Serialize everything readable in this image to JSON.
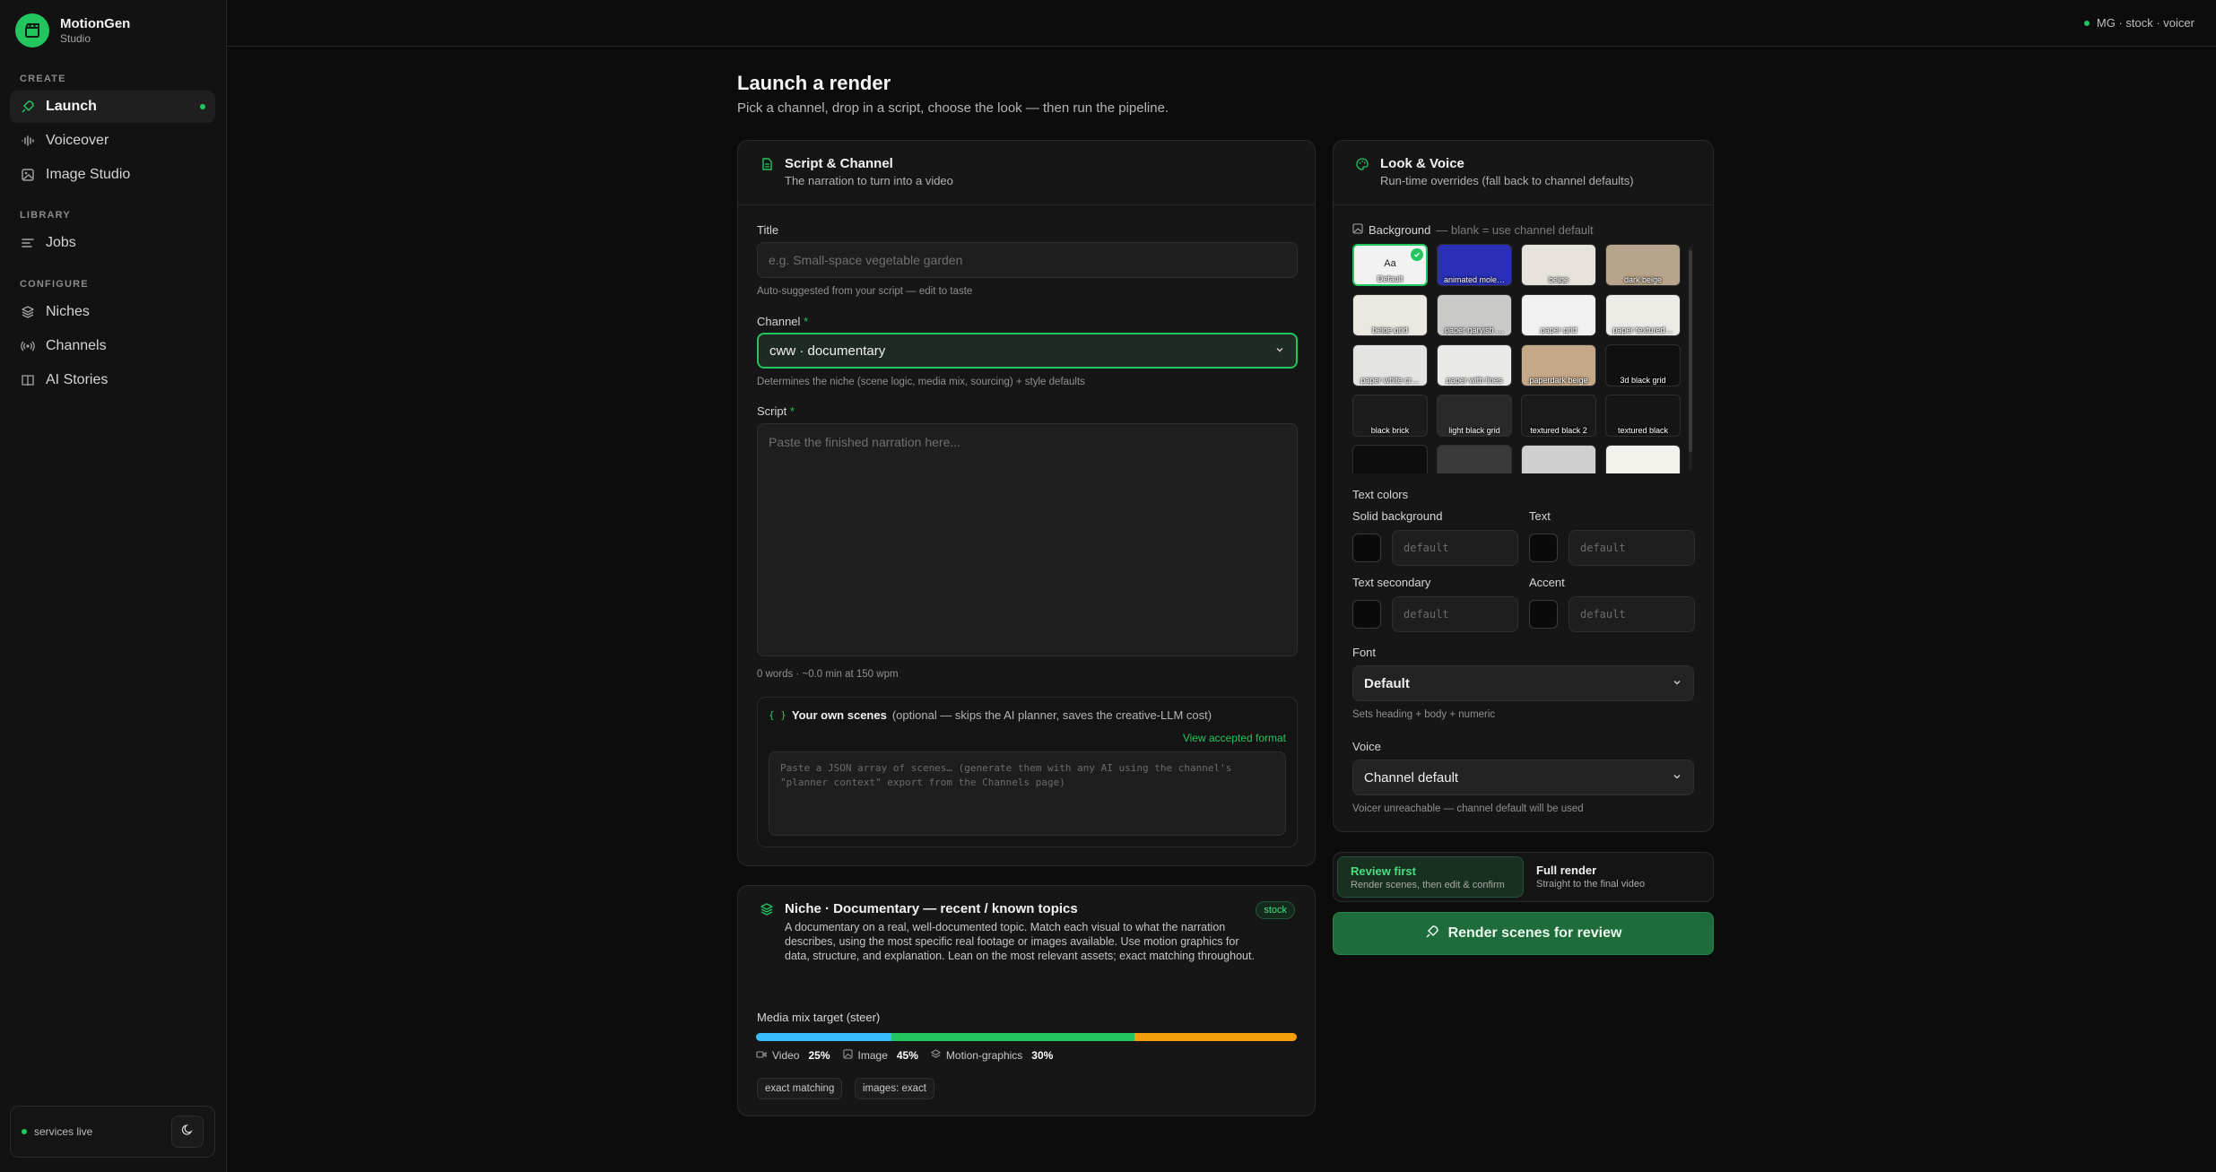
{
  "brand": {
    "name": "MotionGen",
    "sub": "Studio"
  },
  "sidebar": {
    "sections": [
      {
        "label": "CREATE"
      },
      {
        "label": "LIBRARY"
      },
      {
        "label": "CONFIGURE"
      }
    ],
    "items": [
      {
        "label": "Launch",
        "icon": "rocket-icon",
        "active": true
      },
      {
        "label": "Voiceover",
        "icon": "audio-wave-icon"
      },
      {
        "label": "Image Studio",
        "icon": "image-icon"
      },
      {
        "label": "Jobs",
        "icon": "list-icon"
      },
      {
        "label": "Niches",
        "icon": "layers-icon"
      },
      {
        "label": "Channels",
        "icon": "broadcast-icon"
      },
      {
        "label": "AI Stories",
        "icon": "book-icon"
      }
    ],
    "status": "services live"
  },
  "topbar": {
    "status": "MG · stock · voicer"
  },
  "page": {
    "title": "Launch a render",
    "subtitle": "Pick a channel, drop in a script, choose the look — then run the pipeline."
  },
  "script_card": {
    "title": "Script & Channel",
    "subtitle": "The narration to turn into a video",
    "title_label": "Title",
    "title_placeholder": "e.g. Small-space vegetable garden",
    "title_hint": "Auto-suggested from your script — edit to taste",
    "channel_label": "Channel",
    "channel_value": "cww · documentary",
    "channel_hint": "Determines the niche (scene logic, media mix, sourcing) + style defaults",
    "script_label": "Script",
    "script_placeholder": "Paste the finished narration here...",
    "script_stats": "0 words · ~0.0 min at 150 wpm",
    "req_mark": "*",
    "scenes": {
      "icon_text": "{ }",
      "title": "Your own scenes",
      "note": "(optional — skips the AI planner, saves the creative-LLM cost)",
      "link": "View accepted format",
      "placeholder": "Paste a JSON array of scenes… (generate them with any AI using the channel's \"planner context\" export from the Channels page)"
    }
  },
  "niche_card": {
    "title": "Niche · Documentary — recent / known topics",
    "badge": "stock",
    "description": "A documentary on a real, well-documented topic. Match each visual to what the narration describes, using the most specific real footage or images available. Use motion graphics for data, structure, and explanation. Lean on the most relevant assets; exact matching throughout.",
    "mix_label": "Media mix target (steer)",
    "mix": [
      {
        "name": "Video",
        "value": "25%",
        "fraction": 0.25,
        "color": "#38bdf8",
        "icon": "video-icon"
      },
      {
        "name": "Image",
        "value": "45%",
        "fraction": 0.45,
        "color": "#22c55e",
        "icon": "image-icon"
      },
      {
        "name": "Motion-graphics",
        "value": "30%",
        "fraction": 0.3,
        "color": "#f59e0b",
        "icon": "layers-icon"
      }
    ],
    "chips": [
      "exact matching",
      "images: exact"
    ]
  },
  "look_card": {
    "title": "Look & Voice",
    "subtitle": "Run-time overrides (fall back to channel defaults)",
    "background_label": "Background",
    "background_hint": "— blank = use channel default",
    "tiles": [
      {
        "name": "Default",
        "glyph": "Aa",
        "selected": true,
        "color": "#f2f2f2"
      },
      {
        "name": "animated mole…",
        "color": "#2a2fb8"
      },
      {
        "name": "beige",
        "color": "#e7e3dc"
      },
      {
        "name": "dark beige",
        "color": "#b8a48a"
      },
      {
        "name": "beige grid",
        "color": "#ebe8e2"
      },
      {
        "name": "paper garyish …",
        "color": "#c9c9c7"
      },
      {
        "name": "paper grid",
        "color": "#f1f1f1"
      },
      {
        "name": "paper textured…",
        "color": "#ecebe6"
      },
      {
        "name": "paper white cr…",
        "color": "#e4e4e2"
      },
      {
        "name": "paper with lines",
        "color": "#e9e9e7"
      },
      {
        "name": "paperdark beige",
        "color": "#c4a887"
      },
      {
        "name": "3d black grid",
        "color": "#101010"
      },
      {
        "name": "black brick",
        "color": "#1c1c1c"
      },
      {
        "name": "light black grid",
        "color": "#2a2a2a"
      },
      {
        "name": "textured black 2",
        "color": "#1a1a1a"
      },
      {
        "name": "textured black",
        "color": "#161616"
      },
      {
        "name": "",
        "color": "#0d0d0d"
      },
      {
        "name": "",
        "color": "#3a3a3a"
      },
      {
        "name": "",
        "color": "#cfcfcf"
      },
      {
        "name": "",
        "color": "#f4f2ec"
      }
    ],
    "text_colors_label": "Text colors",
    "colors": [
      {
        "label": "Solid background",
        "placeholder": "default"
      },
      {
        "label": "Text",
        "placeholder": "default"
      },
      {
        "label": "Text secondary",
        "placeholder": "default"
      },
      {
        "label": "Accent",
        "placeholder": "default"
      }
    ],
    "font_label": "Font",
    "font_value": "Default",
    "font_hint": "Sets heading + body + numeric",
    "voice_label": "Voice",
    "voice_value": "Channel default",
    "voice_hint": "Voicer unreachable — channel default will be used"
  },
  "modes": [
    {
      "title": "Review first",
      "sub": "Render scenes, then edit & confirm",
      "active": true
    },
    {
      "title": "Full render",
      "sub": "Straight to the final video",
      "active": false
    }
  ],
  "render_button": "Render scenes for review",
  "colors": {
    "accent": "#22c55e",
    "background": "#0c0c0c",
    "card": "#161616"
  }
}
